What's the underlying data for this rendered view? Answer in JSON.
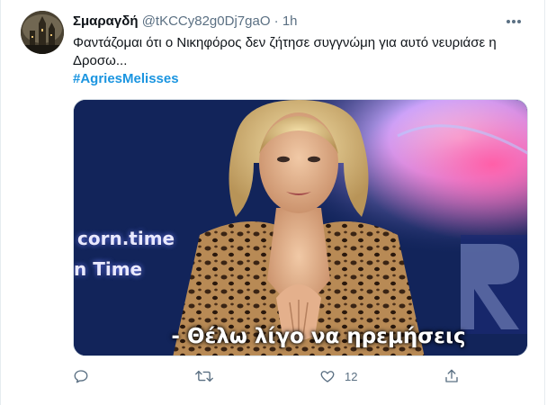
{
  "tweet": {
    "author_name": "Σμαραγδή",
    "handle": "@tKCCy82g0Dj7gaO",
    "separator": "·",
    "time": "1h",
    "text": "Φαντάζομαι ότι ο Νικηφόρος δεν ζήτησε συγγνώμη για αυτό νευριάσε η Δροσω...",
    "hashtag": "#AgriesMelisses",
    "media": {
      "subtitle": "- Θέλω λίγο να ηρεμήσεις",
      "watermark_line1": "corn.time",
      "watermark_line2": "n Time"
    },
    "actions": {
      "reply_icon": "reply-icon",
      "retweet_icon": "retweet-icon",
      "like_icon": "like-icon",
      "like_count": "12",
      "share_icon": "share-icon"
    }
  },
  "colors": {
    "link": "#1b95e0",
    "secondary_text": "#5b7083",
    "border": "#e6ecf0"
  }
}
